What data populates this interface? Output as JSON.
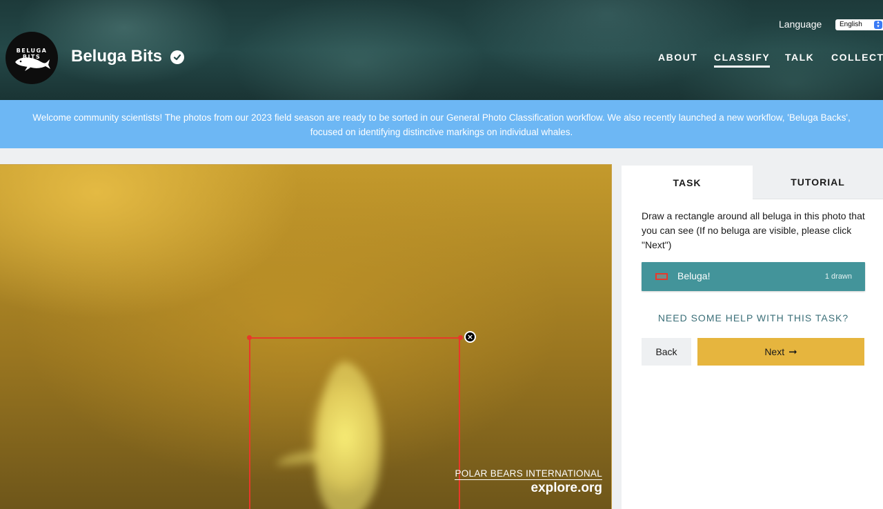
{
  "header": {
    "logo_text_line1": "BELUGA",
    "logo_text_line2": "BITS",
    "project_title": "Beluga Bits",
    "language_label": "Language",
    "language_value": "English",
    "nav": [
      {
        "label": "ABOUT",
        "active": false
      },
      {
        "label": "CLASSIFY",
        "active": true
      },
      {
        "label": "TALK",
        "active": false
      },
      {
        "label": "COLLECT",
        "active": false
      }
    ]
  },
  "announcement": {
    "line1": "Welcome community scientists! The photos from our 2023 field season are ready to be sorted in our General Photo Classification workflow. We also recently launched a new workflow, 'Beluga Backs',",
    "line2": "focused on identifying distinctive markings on individual whales."
  },
  "subject": {
    "watermark_line1": "POLAR BEARS INTERNATIONAL",
    "watermark_line2": "explore.org",
    "delete_mark": "×"
  },
  "panel": {
    "tabs": [
      {
        "label": "TASK",
        "active": true
      },
      {
        "label": "TUTORIAL",
        "active": false
      }
    ],
    "instructions": "Draw a rectangle around all beluga in this photo that you can see (If no beluga are visible, please click \"Next\")",
    "tool": {
      "label": "Beluga!",
      "count": "1 drawn",
      "color": "#e8382a"
    },
    "help_link": "NEED SOME HELP WITH THIS TASK?",
    "back_label": "Back",
    "next_label": "Next",
    "next_arrow": "➞"
  },
  "colors": {
    "announcement_bg": "#6db7f4",
    "tool_bg": "#43949a",
    "next_bg": "#e6b53e",
    "rect_color": "#e8382a"
  }
}
